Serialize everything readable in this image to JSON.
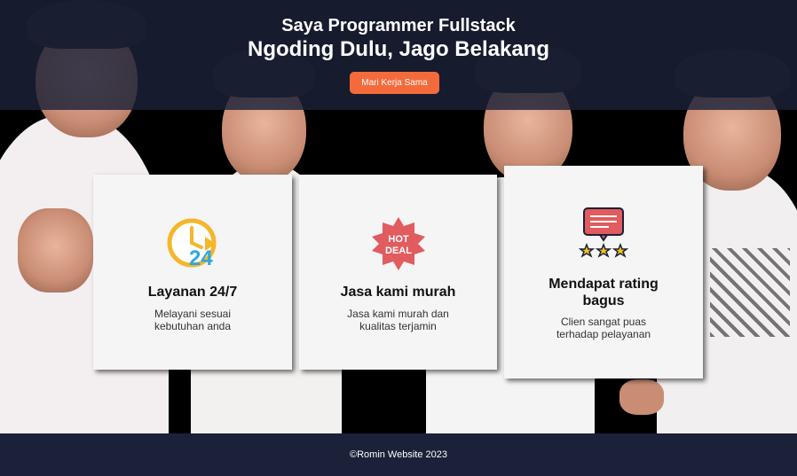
{
  "header": {
    "title": "Saya Programmer Fullstack",
    "subtitle": "Ngoding Dulu, Jago Belakang",
    "cta_label": "Mari Kerja Sama"
  },
  "cards": [
    {
      "icon": "clock-24-icon",
      "title": "Layanan 24/7",
      "desc": "Melayani sesuai kebutuhan anda"
    },
    {
      "icon": "hot-deal-icon",
      "title": "Jasa kami murah",
      "desc": "Jasa kami murah dan kualitas terjamin"
    },
    {
      "icon": "rating-icon",
      "title": "Mendapat rating bagus",
      "desc": "Clien sangat puas terhadap pelayanan"
    }
  ],
  "hot_deal": {
    "line1": "HOT",
    "line2": "DEAL"
  },
  "clock": {
    "label": "24"
  },
  "footer": {
    "text": "©Romin Website 2023"
  },
  "colors": {
    "header_bg": "#1b2138",
    "cta": "#f46b3b",
    "card_bg": "#f5f5f5",
    "footer_bg": "#1b2138"
  }
}
